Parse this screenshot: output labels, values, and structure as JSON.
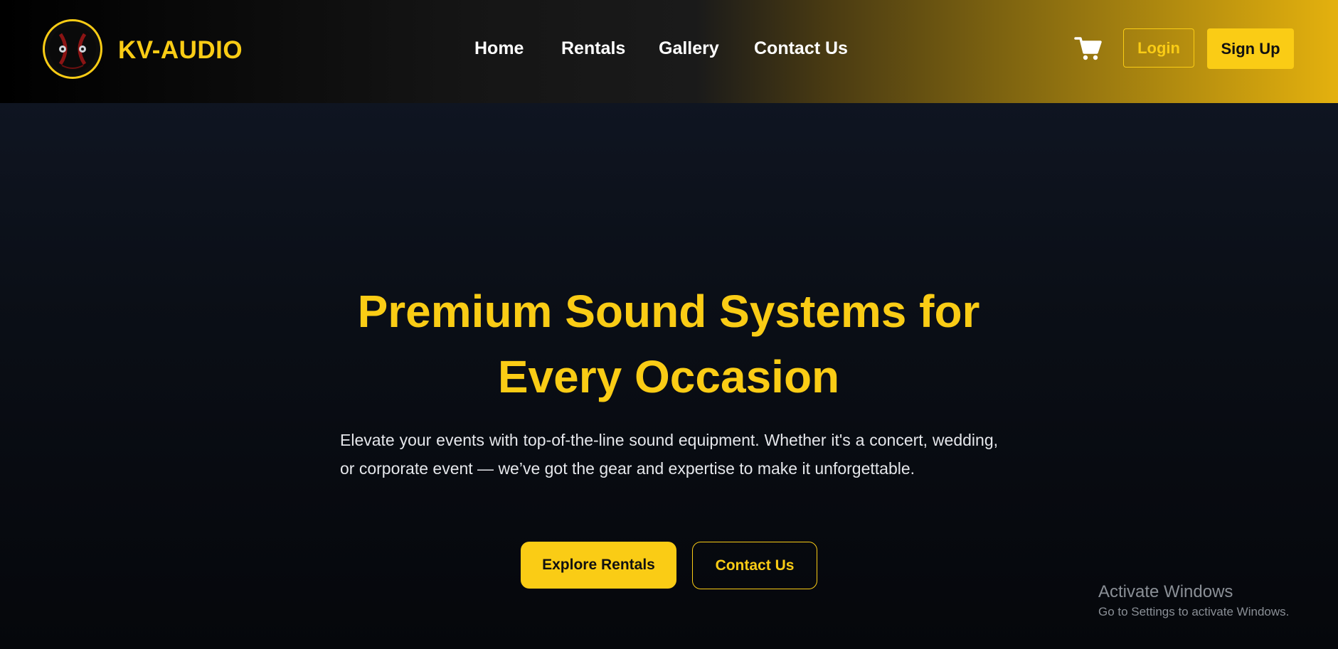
{
  "brand": {
    "name": "KV-AUDIO",
    "logo_icon": "speaker-logo-icon",
    "accent_color": "#facc15"
  },
  "nav": {
    "items": [
      {
        "label": "Home"
      },
      {
        "label": "Rentals"
      },
      {
        "label": "Gallery"
      },
      {
        "label": "Contact Us"
      }
    ]
  },
  "header_actions": {
    "cart_icon": "shopping-cart-icon",
    "login_label": "Login",
    "signup_label": "Sign Up"
  },
  "hero": {
    "title_line1": "Premium Sound Systems for",
    "title_line2": "Every Occasion",
    "description": "Elevate your events with top-of-the-line sound equipment. Whether it's a concert, wedding, or corporate event — we’ve got the gear and expertise to make it unforgettable.",
    "primary_button": "Explore Rentals",
    "secondary_button": "Contact Us"
  },
  "watermark": {
    "title": "Activate Windows",
    "subtitle": "Go to Settings to activate Windows."
  },
  "colors": {
    "background": "#0b0f17",
    "header_gradient_end": "#e4b10e",
    "text_light": "#e5e7eb"
  }
}
